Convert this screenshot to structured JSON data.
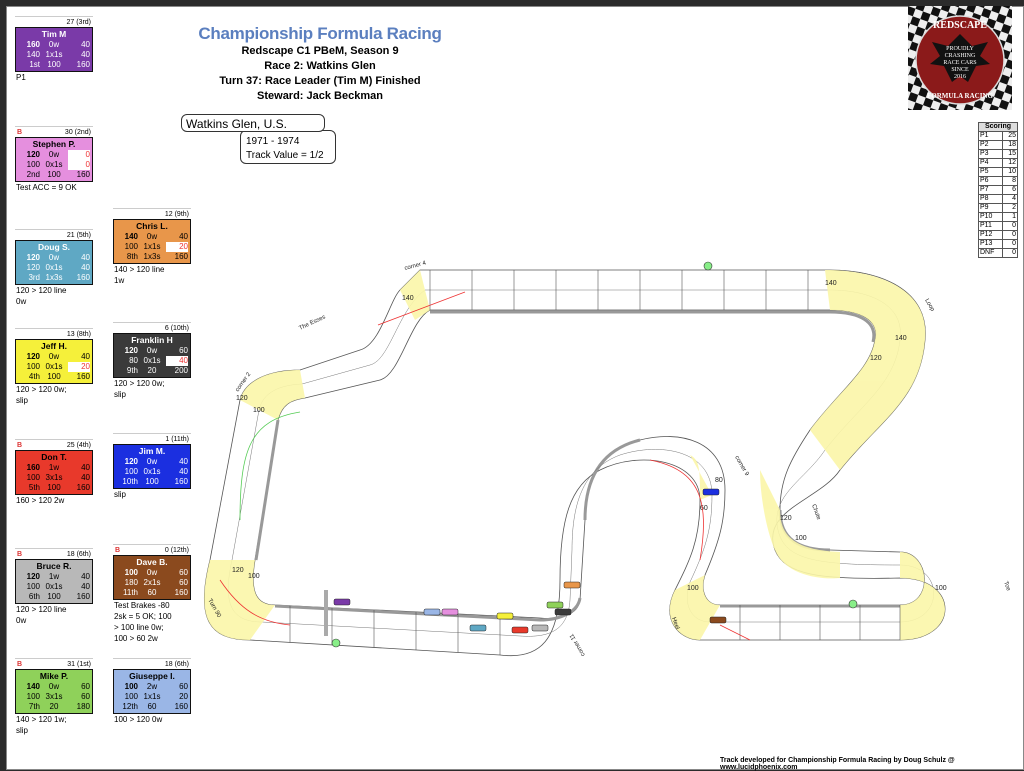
{
  "header": {
    "title": "Championship Formula Racing",
    "lines": [
      "Redscape C1 PBeM, Season 9",
      "Race 2: Watkins Glen",
      "Turn 37: Race Leader (Tim M) Finished",
      "Steward: Jack Beckman"
    ]
  },
  "track": {
    "name": "Watkins Glen, U.S.",
    "years": "1971 - 1974",
    "value": "Track Value = 1/2",
    "corners": [
      "corner 2",
      "The Esses",
      "corner 4",
      "Loop",
      "Chute",
      "Toe",
      "Heel",
      "corner 9",
      "corner 11",
      "Turn 90"
    ]
  },
  "logo": {
    "top": "REDSCAPE",
    "middle": [
      "PROUDLY",
      "CRASHING",
      "RACE CARS",
      "SINCE",
      "2016"
    ],
    "bottom": "FORMULA RACING",
    "colors": {
      "ring": "#8b1a1a",
      "eagle": "#111111"
    }
  },
  "scoring": {
    "title": "Scoring",
    "rows": [
      [
        "P1",
        "25"
      ],
      [
        "P2",
        "18"
      ],
      [
        "P3",
        "15"
      ],
      [
        "P4",
        "12"
      ],
      [
        "P5",
        "10"
      ],
      [
        "P6",
        "8"
      ],
      [
        "P7",
        "6"
      ],
      [
        "P8",
        "4"
      ],
      [
        "P9",
        "2"
      ],
      [
        "P10",
        "1"
      ],
      [
        "P11",
        "0"
      ],
      [
        "P12",
        "0"
      ],
      [
        "P13",
        "0"
      ],
      [
        "DNF",
        "0"
      ]
    ]
  },
  "cards": [
    {
      "flag": "",
      "points": "27 (3rd)",
      "name": "Tim M",
      "color": "#7a3aa8",
      "text": "#fff",
      "rows": [
        [
          "160",
          "0w",
          "40"
        ],
        [
          "140",
          "1x1s",
          "40"
        ],
        [
          "1st",
          "100",
          "160"
        ]
      ],
      "hl": [],
      "notes": [
        "P1"
      ]
    },
    {
      "flag": "B",
      "points": "30 (2nd)",
      "name": "Stephen P.",
      "color": "#e58fde",
      "text": "#000",
      "rows": [
        [
          "120",
          "0w",
          "0"
        ],
        [
          "100",
          "0x1s",
          "0"
        ],
        [
          "2nd",
          "100",
          "160"
        ]
      ],
      "hl": [
        [
          0,
          2
        ],
        [
          1,
          2
        ]
      ],
      "notes": [
        "Test ACC = 9 OK"
      ]
    },
    {
      "flag": "",
      "points": "21 (5th)",
      "name": "Doug S.",
      "color": "#5fa8c4",
      "text": "#fff",
      "rows": [
        [
          "120",
          "0w",
          "40"
        ],
        [
          "120",
          "0x1s",
          "40"
        ],
        [
          "3rd",
          "1x3s",
          "160"
        ]
      ],
      "hl": [],
      "notes": [
        "120 > 120 line",
        "0w"
      ]
    },
    {
      "flag": "",
      "points": "13 (8th)",
      "name": "Jeff H.",
      "color": "#f5f03a",
      "text": "#000",
      "rows": [
        [
          "120",
          "0w",
          "40"
        ],
        [
          "100",
          "0x1s",
          "20"
        ],
        [
          "4th",
          "100",
          "160"
        ]
      ],
      "hl": [
        [
          1,
          2
        ]
      ],
      "notes": [
        "120 > 120 0w;",
        "slip"
      ]
    },
    {
      "flag": "B",
      "points": "25 (4th)",
      "name": "Don T.",
      "color": "#e8392b",
      "text": "#000",
      "rows": [
        [
          "160",
          "1w",
          "40"
        ],
        [
          "100",
          "3x1s",
          "40"
        ],
        [
          "5th",
          "100",
          "160"
        ]
      ],
      "hl": [],
      "notes": [
        "160 > 120 2w"
      ]
    },
    {
      "flag": "B",
      "points": "18 (6th)",
      "name": "Bruce R.",
      "color": "#b8b8b8",
      "text": "#000",
      "rows": [
        [
          "120",
          "1w",
          "40"
        ],
        [
          "100",
          "0x1s",
          "40"
        ],
        [
          "6th",
          "100",
          "160"
        ]
      ],
      "hl": [],
      "notes": [
        "120 > 120 line",
        "0w"
      ]
    },
    {
      "flag": "B",
      "points": "31 (1st)",
      "name": "Mike P.",
      "color": "#8fd15a",
      "text": "#000",
      "rows": [
        [
          "140",
          "0w",
          "60"
        ],
        [
          "100",
          "3x1s",
          "60"
        ],
        [
          "7th",
          "20",
          "180"
        ]
      ],
      "hl": [],
      "notes": [
        "140 > 120  1w;",
        "slip"
      ]
    },
    {
      "flag": "",
      "points": "12 (9th)",
      "name": "Chris L.",
      "color": "#e8964a",
      "text": "#000",
      "rows": [
        [
          "140",
          "0w",
          "40"
        ],
        [
          "100",
          "1x1s",
          "20"
        ],
        [
          "8th",
          "1x3s",
          "160"
        ]
      ],
      "hl": [
        [
          1,
          2
        ]
      ],
      "notes": [
        "140 > 120 line",
        "1w"
      ]
    },
    {
      "flag": "",
      "points": "6 (10th)",
      "name": "Franklin H",
      "color": "#3a3a3a",
      "text": "#fff",
      "rows": [
        [
          "120",
          "0w",
          "60"
        ],
        [
          "80",
          "0x1s",
          "40"
        ],
        [
          "9th",
          "20",
          "200"
        ]
      ],
      "hl": [
        [
          1,
          2
        ]
      ],
      "notes": [
        "120 > 120 0w;",
        "slip"
      ]
    },
    {
      "flag": "",
      "points": "1 (11th)",
      "name": "Jim M.",
      "color": "#1b2fe0",
      "text": "#fff",
      "rows": [
        [
          "120",
          "0w",
          "40"
        ],
        [
          "100",
          "0x1s",
          "40"
        ],
        [
          "10th",
          "100",
          "160"
        ]
      ],
      "hl": [],
      "notes": [
        "slip"
      ]
    },
    {
      "flag": "B",
      "points": "0 (12th)",
      "name": "Dave B.",
      "color": "#8b4a1e",
      "text": "#fff",
      "rows": [
        [
          "100",
          "0w",
          "60"
        ],
        [
          "180",
          "2x1s",
          "60"
        ],
        [
          "11th",
          "60",
          "160"
        ]
      ],
      "hl": [],
      "notes": [
        "Test Brakes -80",
        "2sk = 5 OK; 100",
        "> 100 line 0w;",
        "100 > 60 2w"
      ]
    },
    {
      "flag": "",
      "points": "18 (6th)",
      "name": "Giuseppe I.",
      "color": "#9ab6e6",
      "text": "#000",
      "rows": [
        [
          "100",
          "2w",
          "60"
        ],
        [
          "100",
          "1x1s",
          "20"
        ],
        [
          "12th",
          "60",
          "160"
        ]
      ],
      "hl": [],
      "notes": [
        "100 > 120 0w"
      ]
    }
  ],
  "footer": "Track developed for Championship Formula Racing by Doug Schulz @ www.lucidphoenix.com"
}
